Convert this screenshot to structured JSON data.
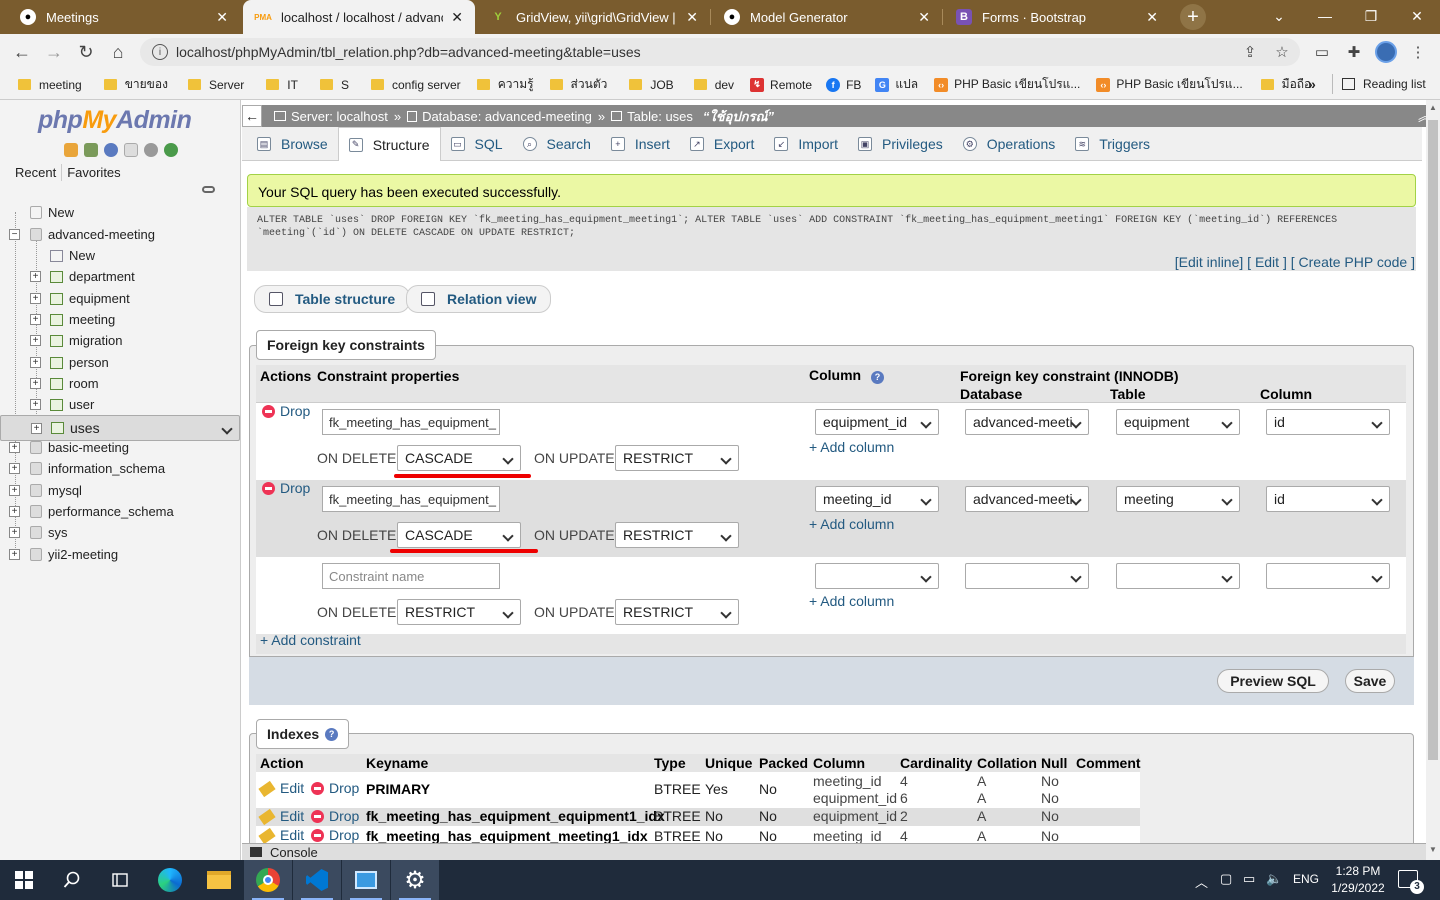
{
  "browser": {
    "tabs": [
      {
        "label": "Meetings",
        "icon": "G"
      },
      {
        "label": "localhost / localhost / advanced",
        "icon": "PMA"
      },
      {
        "label": "GridView, yii\\grid\\GridView | AP",
        "icon": "Y"
      },
      {
        "label": "Model Generator",
        "icon": "G"
      },
      {
        "label": "Forms · Bootstrap",
        "icon": "B"
      }
    ],
    "url": "localhost/phpMyAdmin/tbl_relation.php?db=advanced-meeting&table=uses",
    "bookmarks": [
      "meeting",
      "ขายของ",
      "Server",
      "IT",
      "S",
      "config server",
      "ความรู้",
      "ส่วนตัว",
      "JOB",
      "dev",
      "Remote",
      "FB",
      "แปล",
      "PHP Basic เขียนโปรแ...",
      "PHP Basic เขียนโปรแ...",
      "มือถือ"
    ],
    "reading_list": "Reading list",
    "overflow": "»"
  },
  "pma": {
    "logo": {
      "php": "php",
      "my": "My",
      "admin": "Admin"
    },
    "recent": "Recent",
    "favorites": "Favorites",
    "tree": {
      "new_top": "New",
      "db_open": "advanced-meeting",
      "new_table": "New",
      "tables": [
        "department",
        "equipment",
        "meeting",
        "migration",
        "person",
        "room",
        "user",
        "uses"
      ],
      "other_dbs": [
        "basic-meeting",
        "information_schema",
        "mysql",
        "performance_schema",
        "sys",
        "yii2-meeting"
      ]
    },
    "breadcrumb": {
      "server": "Server: localhost",
      "database": "Database: advanced-meeting",
      "table": "Table: uses",
      "comment": "“ใช้อุปกรณ์”",
      "sep": "»"
    },
    "menu": [
      "Browse",
      "Structure",
      "SQL",
      "Search",
      "Insert",
      "Export",
      "Import",
      "Privileges",
      "Operations",
      "Triggers"
    ],
    "success": "Your SQL query has been executed successfully.",
    "sql_line1": "ALTER TABLE `uses` DROP FOREIGN KEY `fk_meeting_has_equipment_meeting1`; ALTER TABLE `uses` ADD CONSTRAINT `fk_meeting_has_equipment_meeting1` FOREIGN KEY (`meeting_id`) REFERENCES",
    "sql_line2": "`meeting`(`id`) ON DELETE CASCADE ON UPDATE RESTRICT;",
    "sql_links": {
      "edit_inline": "Edit inline",
      "edit": "Edit",
      "create_php": "Create PHP code"
    },
    "view_tabs": {
      "structure": "Table structure",
      "relation": "Relation view"
    },
    "fk": {
      "legend": "Foreign key constraints",
      "headers": {
        "actions": "Actions",
        "props": "Constraint properties",
        "column": "Column",
        "fk": "Foreign key constraint (INNODB)",
        "database": "Database",
        "table": "Table",
        "column2": "Column"
      },
      "drop": "Drop",
      "on_delete": "ON DELETE",
      "on_update": "ON UPDATE",
      "add_column": "+ Add column",
      "rows": [
        {
          "name": "fk_meeting_has_equipment_",
          "column": "equipment_id",
          "database": "advanced-meeti",
          "table": "equipment",
          "ref_column": "id",
          "on_delete": "CASCADE",
          "on_update": "RESTRICT"
        },
        {
          "name": "fk_meeting_has_equipment_",
          "column": "meeting_id",
          "database": "advanced-meeti",
          "table": "meeting",
          "ref_column": "id",
          "on_delete": "CASCADE",
          "on_update": "RESTRICT"
        }
      ],
      "new_row": {
        "placeholder": "Constraint name",
        "on_delete": "RESTRICT",
        "on_update": "RESTRICT"
      },
      "add_constraint": "+ Add constraint",
      "preview_sql": "Preview SQL",
      "save": "Save"
    },
    "indexes": {
      "legend": "Indexes",
      "headers": [
        "Action",
        "Keyname",
        "Type",
        "Unique",
        "Packed",
        "Column",
        "Cardinality",
        "Collation",
        "Null",
        "Comment"
      ],
      "edit": "Edit",
      "drop": "Drop",
      "rows": [
        {
          "keyname": "PRIMARY",
          "type": "BTREE",
          "unique": "Yes",
          "packed": "No",
          "columns": [
            "meeting_id",
            "equipment_id"
          ],
          "cardinality": [
            "4",
            "6"
          ],
          "collation": [
            "A",
            "A"
          ],
          "null": [
            "No",
            "No"
          ]
        },
        {
          "keyname": "fk_meeting_has_equipment_equipment1_idx",
          "type": "BTREE",
          "unique": "No",
          "packed": "No",
          "columns": [
            "equipment_id"
          ],
          "cardinality": [
            "2"
          ],
          "collation": [
            "A"
          ],
          "null": [
            "No"
          ]
        },
        {
          "keyname": "fk_meeting_has_equipment_meeting1_idx",
          "type": "BTREE",
          "unique": "No",
          "packed": "No",
          "columns": [
            "meeting_id"
          ],
          "cardinality": [
            "4"
          ],
          "collation": [
            "A"
          ],
          "null": [
            "No"
          ]
        }
      ]
    },
    "console": "Console"
  },
  "taskbar": {
    "lang": "ENG",
    "time": "1:28 PM",
    "date": "1/29/2022",
    "notif_count": "3"
  },
  "colors": {
    "accent_red": "#e00000",
    "link": "#235a81",
    "success_bg": "#ebf8a4"
  }
}
